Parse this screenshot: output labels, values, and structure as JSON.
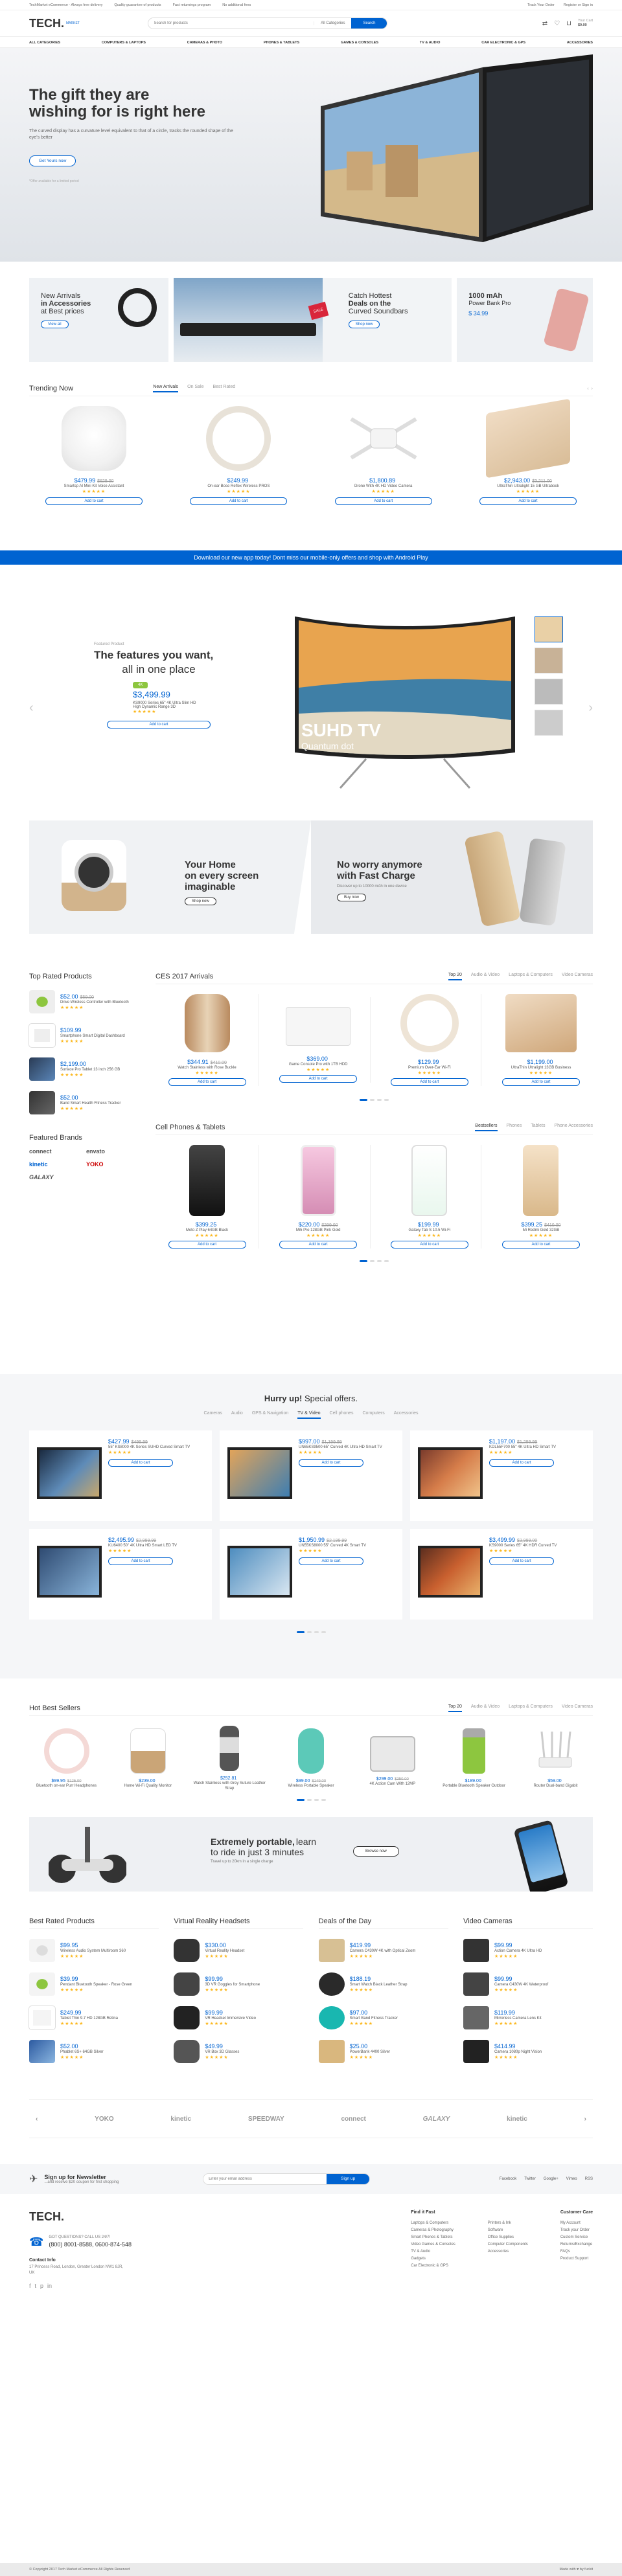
{
  "topbar": {
    "welcome": "TechMarket eCommerce - Always free delivery",
    "promos": [
      "Quality guarantee of products",
      "Fast returnings program",
      "No additional fees"
    ],
    "track": "Track Your Order",
    "account": "Register or Sign in"
  },
  "header": {
    "logo": "TECH.",
    "logo_sub": "MARKET",
    "search_placeholder": "Search for products",
    "category_select": "All Categories",
    "search_button": "Search",
    "cart_label": "Your Cart",
    "cart_total": "$0.00"
  },
  "nav": [
    "ALL CATEGORIES",
    "COMPUTERS & LAPTOPS",
    "CAMERAS & PHOTO",
    "PHONES & TABLETS",
    "GAMES & CONSOLES",
    "TV & AUDIO",
    "CAR ELECTRONIC & GPS",
    "ACCESSORIES"
  ],
  "hero": {
    "title_a": "The gift they are",
    "title_b": "wishing for is right here",
    "text": "The curved display has a curvature level equivalent to that of a circle, tracks the rounded shape of the eye's better",
    "button": "Get Yours now",
    "note": "*Offer available for a limited period",
    "colors": {
      "bg": "#e8ebee"
    }
  },
  "banners": [
    {
      "line1": "New Arrivals",
      "line2": "in Accessories",
      "line3": "at Best prices",
      "btn": "View all"
    },
    {
      "line1": "Catch Hottest",
      "line2": "Deals on the",
      "line3": "Curved Soundbars",
      "btn": "Shop now",
      "tag": "SALE"
    },
    {
      "line1": "1000 mAh",
      "line2": "Power Bank Pro",
      "line3": "$ 34.99",
      "btn": ""
    }
  ],
  "trending": {
    "title": "Trending Now",
    "tabs": [
      "New Arrivals",
      "On Sale",
      "Best Rated"
    ],
    "items": [
      {
        "price": "$479.99",
        "old": "$629.00",
        "name": "Smartsp AI Mini Kit Voice Assistant",
        "cart": "Add to cart"
      },
      {
        "price": "$249.99",
        "old": "",
        "name": "On-ear Bose Reflex Wireless PROS",
        "cart": "Add to cart"
      },
      {
        "price": "$1,800.89",
        "old": "",
        "name": "Drone With 4K HD Video Camera",
        "cart": "Add to cart"
      },
      {
        "price": "$2,943.00",
        "old": "$3,211.00",
        "name": "UltraThin Ultralight 15 GB Ultrabook",
        "cart": "Add to cart"
      }
    ]
  },
  "appbar": {
    "text": "Download our new app today! Dont miss our mobile-only offers and shop with Android Play"
  },
  "featured": {
    "tag": "Featured Product",
    "title_a": "The features you want,",
    "title_b": "all in one place",
    "badge": "4K",
    "price": "$3,499.99",
    "name_a": "KS9000 Series 65\" 4K Ultra Slim HD",
    "name_b": "High Dynamic Range 3D",
    "cart": "Add to cart",
    "suhd": "SUHD TV",
    "quantum": "Quantum dot"
  },
  "promo": [
    {
      "title_a": "Your Home",
      "title_b": "on every screen",
      "title_c": "imaginable",
      "btn": "Shop now"
    },
    {
      "title_a": "No worry anymore",
      "title_b": "with Fast Charge",
      "sub": "Discover up to 10000 mAh in one device",
      "btn": "Buy now"
    }
  ],
  "toprated": {
    "title": "Top Rated Products",
    "items": [
      {
        "price": "$52.00",
        "old": "$59.00",
        "name": "Drive Wireless Controller with Bluetooth"
      },
      {
        "price": "$109.99",
        "old": "",
        "name": "Smartphone Smart Digital Dashboard"
      },
      {
        "price": "$2,199.00",
        "old": "",
        "name": "Surface Pro Tablet 13 inch 256 GB"
      },
      {
        "price": "$52.00",
        "old": "",
        "name": "Band Smart Health Fitness Tracker"
      }
    ]
  },
  "brands": {
    "title": "Featured Brands",
    "list": [
      "connect",
      "envato",
      "kinetic",
      "YOKO",
      "GALAXY"
    ]
  },
  "ces": {
    "title": "CES 2017 Arrivals",
    "tabs": [
      "Top 20",
      "Audio & Video",
      "Laptops & Computers",
      "Video Cameras"
    ],
    "items": [
      {
        "price": "$344.91",
        "old": "$410.00",
        "name": "Watch Stainless with Rose Buckle"
      },
      {
        "price": "$369.00",
        "old": "",
        "name": "Game Console Pro with 1TB HDD"
      },
      {
        "price": "$129.99",
        "old": "",
        "name": "Premium Over-Ear Wi-Fi"
      },
      {
        "price": "$1,199.00",
        "old": "",
        "name": "UltraThin Ultralight 13GB Business"
      }
    ],
    "cart": "Add to cart"
  },
  "phones": {
    "title": "Cell Phones & Tablets",
    "tabs": [
      "Bestsellers",
      "Phones",
      "Tablets",
      "Phone Accessories"
    ],
    "items": [
      {
        "price": "$399.25",
        "old": "",
        "name": "Moto Z Play 64GB Black"
      },
      {
        "price": "$220.00",
        "old": "$299.00",
        "name": "Mi5 Pro 128GB Pink Gold"
      },
      {
        "price": "$199.99",
        "old": "",
        "name": "Galaxy Tab S 10.5 Wi-Fi"
      },
      {
        "price": "$399.25",
        "old": "$410.00",
        "name": "Mi Redmi Gold 32GB"
      }
    ],
    "cart": "Add to cart"
  },
  "hurry": {
    "title_a": "Hurry up!",
    "title_b": "Special offers.",
    "tabs": [
      "Cameras",
      "Audio",
      "GPS & Navigation",
      "TV & Video",
      "Cell phones",
      "Computers",
      "Accessories"
    ],
    "items": [
      {
        "price": "$427.99",
        "old": "$499.99",
        "name": "55\" KS8000 4K Series SUHD Curved Smart TV"
      },
      {
        "price": "$997.00",
        "old": "$1,199.99",
        "name": "UN65KS9500 65\" Curved 4K Ultra HD Smart TV"
      },
      {
        "price": "$1,197.00",
        "old": "$1,299.99",
        "name": "KDL55F700 55\" 4K Ultra HD Smart TV"
      },
      {
        "price": "$2,495.99",
        "old": "$2,999.99",
        "name": "KU6400 50\" 4K Ultra HD Smart LED TV"
      },
      {
        "price": "$1,950.99",
        "old": "$2,199.99",
        "name": "UN55KS8000 55\" Curved 4K Smart TV"
      },
      {
        "price": "$3,499.99",
        "old": "$3,999.00",
        "name": "KS9000 Series 65\" 4K HDR Curved TV"
      }
    ],
    "cart": "Add to cart"
  },
  "hotbest": {
    "title": "Hot Best Sellers",
    "tabs": [
      "Top 20",
      "Audio & Video",
      "Laptops & Computers",
      "Video Cameras"
    ],
    "items": [
      {
        "price": "$99.95",
        "old": "$125.00",
        "name": "Bluetooth on-ear Purr Headphones"
      },
      {
        "price": "$239.00",
        "old": "",
        "name": "Home Wi-Fi Quality Monitor"
      },
      {
        "price": "$252.81",
        "old": "",
        "name": "Watch Stainless with Grey Suture Leather Strap"
      },
      {
        "price": "$99.00",
        "old": "$149.00",
        "name": "Wireless Portable Speaker"
      },
      {
        "price": "$299.00",
        "old": "$350.00",
        "name": "4K Action Cam With 12MP"
      },
      {
        "price": "$189.00",
        "old": "",
        "name": "Portable Bluetooth Speaker Outdoor"
      },
      {
        "price": "$59.00",
        "old": "",
        "name": "Router Dual-band Gigabit"
      }
    ]
  },
  "portable": {
    "title_a": "Extremely portable,",
    "title_b": "learn",
    "title_c": "to ride in just 3 minutes",
    "sub": "Travel up to 20km in a single charge",
    "btn": "Browse now"
  },
  "bottomlists": [
    {
      "title": "Best Rated Products",
      "items": [
        {
          "price": "$99.95",
          "name": "Wireless Audio System Multiroom 360"
        },
        {
          "price": "$39.99",
          "name": "Pendant Bluetooth Speaker - Rose Green"
        },
        {
          "price": "$249.99",
          "name": "Tablet Thin 9.7 HD 128GB Retina"
        },
        {
          "price": "$52.00",
          "name": "Phablet 6S+ 64GB Silver"
        }
      ]
    },
    {
      "title": "Virtual Reality Headsets",
      "items": [
        {
          "price": "$330.00",
          "name": "Virtual Reality Headset"
        },
        {
          "price": "$99.99",
          "name": "3D VR Goggles for Smartphone"
        },
        {
          "price": "$99.99",
          "name": "VR Headset Immersive Video"
        },
        {
          "price": "$49.99",
          "name": "VR Box 3D Glasses"
        }
      ]
    },
    {
      "title": "Deals of the Day",
      "items": [
        {
          "price": "$419.99",
          "name": "Camera C430W 4K with Optical Zoom"
        },
        {
          "price": "$188.19",
          "name": "Smart Watch Black Leather Strap"
        },
        {
          "price": "$97.00",
          "name": "Smart Band Fitness Tracker"
        },
        {
          "price": "$25.00",
          "name": "PowerBank 4400 Silver"
        }
      ]
    },
    {
      "title": "Video Cameras",
      "items": [
        {
          "price": "$99.99",
          "name": "Action Camera 4K Ultra HD"
        },
        {
          "price": "$99.99",
          "name": "Camera C430W 4K Waterproof"
        },
        {
          "price": "$119.99",
          "name": "Mirrorless Camera Lens Kit"
        },
        {
          "price": "$414.99",
          "name": "Camera 1080p Night Vision"
        }
      ]
    }
  ],
  "brandstrip": [
    "YOKO",
    "kinetic",
    "SPEEDWAY",
    "connect",
    "GALAXY",
    "kinetic"
  ],
  "newsletter": {
    "title": "Sign up for Newsletter",
    "sub": "...and receive $20 coupon for first shopping",
    "placeholder": "Enter your email address",
    "btn": "Sign up",
    "social": [
      "Facebook",
      "Twitter",
      "Google+",
      "Vimeo",
      "RSS"
    ]
  },
  "footer": {
    "logo": "TECH.",
    "support": "GOT QUESTIONS? CALL US 24/7!",
    "phone": "(800) 8001-8588, 0600-874-548",
    "contact": "Contact Info",
    "address": "17 Princess Road, London, Greater London NW1 8JR, UK",
    "cols": [
      {
        "title": "Find it Fast",
        "links": [
          "Laptops & Computers",
          "Cameras & Photography",
          "Smart Phones & Tablets",
          "Video Games & Consoles",
          "TV & Audio",
          "Gadgets",
          "Car Electronic & GPS"
        ]
      },
      {
        "title": "",
        "links": [
          "Printers & Ink",
          "Software",
          "Office Supplies",
          "Computer Components",
          "Accessories"
        ]
      },
      {
        "title": "Customer Care",
        "links": [
          "My Account",
          "Track your Order",
          "Custom Service",
          "Returns/Exchange",
          "FAQs",
          "Product Support"
        ]
      }
    ],
    "copy": "© Copyright 2017 Tech Market eCommerce All Rights Reserved",
    "madeby": "Made with ♥ by fuckit"
  }
}
